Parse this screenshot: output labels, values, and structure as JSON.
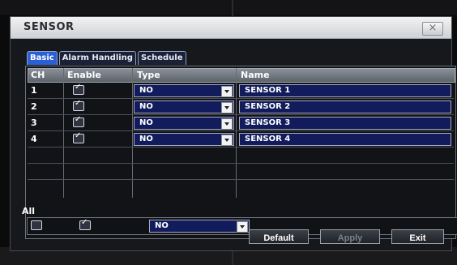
{
  "window": {
    "title": "SENSOR",
    "close_icon": "close-icon"
  },
  "tabs": [
    {
      "label": "Basic",
      "active": true
    },
    {
      "label": "Alarm Handling",
      "active": false
    },
    {
      "label": "Schedule",
      "active": false
    }
  ],
  "table": {
    "headers": [
      "CH",
      "Enable",
      "Type",
      "Name"
    ],
    "rows": [
      {
        "ch": "1",
        "enabled": true,
        "type": "NO",
        "name": "SENSOR 1"
      },
      {
        "ch": "2",
        "enabled": true,
        "type": "NO",
        "name": "SENSOR 2"
      },
      {
        "ch": "3",
        "enabled": true,
        "type": "NO",
        "name": "SENSOR 3"
      },
      {
        "ch": "4",
        "enabled": true,
        "type": "NO",
        "name": "SENSOR 4"
      }
    ]
  },
  "all": {
    "label": "All",
    "enabled": true,
    "type": "NO"
  },
  "buttons": {
    "default": "Default",
    "apply": "Apply",
    "exit": "Exit"
  },
  "colors": {
    "field_bg": "#121b5c",
    "tab_active": "#2b5fd6",
    "titlebar": "#dfe2e6"
  }
}
